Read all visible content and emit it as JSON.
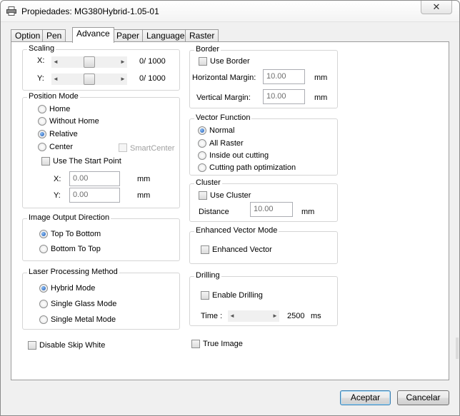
{
  "window": {
    "title": "Propiedades: MG380Hybrid-1.05-01",
    "close_glyph": "✕",
    "icon": "printer-icon"
  },
  "tabs": [
    {
      "label": "Option"
    },
    {
      "label": "Pen"
    },
    {
      "label": "Advance",
      "active": true
    },
    {
      "label": "Paper"
    },
    {
      "label": "Language"
    },
    {
      "label": "Raster"
    }
  ],
  "scaling": {
    "legend": "Scaling",
    "x_label": "X:",
    "x_value": "0/ 1000",
    "x_level": 0.5,
    "y_label": "Y:",
    "y_value": "0/ 1000",
    "y_level": 0.5
  },
  "position_mode": {
    "legend": "Position Mode",
    "options": [
      "Home",
      "Without Home",
      "Relative",
      "Center"
    ],
    "selected": "Relative",
    "smart_center": "SmartCenter",
    "use_start_point": "Use The Start Point",
    "x_label": "X:",
    "x_value": "0.00",
    "x_unit": "mm",
    "y_label": "Y:",
    "y_value": "0.00",
    "y_unit": "mm"
  },
  "image_output": {
    "legend": "Image Output Direction",
    "options": [
      "Top To Bottom",
      "Bottom To Top"
    ],
    "selected": "Top To Bottom"
  },
  "laser_processing": {
    "legend": "Laser Processing Method",
    "options": [
      "Hybrid Mode",
      "Single Glass Mode",
      "Single Metal Mode"
    ],
    "selected": "Hybrid Mode"
  },
  "disable_skip_white": "Disable Skip White",
  "border": {
    "legend": "Border",
    "use_border": "Use Border",
    "h_margin_label": "Horizontal Margin:",
    "h_margin_value": "10.00",
    "h_unit": "mm",
    "v_margin_label": "Vertical Margin:",
    "v_margin_value": "10.00",
    "v_unit": "mm"
  },
  "vector_function": {
    "legend": "Vector Function",
    "options": [
      "Normal",
      "All Raster",
      "Inside out cutting",
      "Cutting path optimization"
    ],
    "selected": "Normal"
  },
  "cluster": {
    "legend": "Cluster",
    "use_cluster": "Use Cluster",
    "distance_label": "Distance",
    "distance_value": "10.00",
    "unit": "mm"
  },
  "enhanced_vector": {
    "legend": "Enhanced Vector Mode",
    "checkbox": "Enhanced Vector"
  },
  "drilling": {
    "legend": "Drilling",
    "enable": "Enable Drilling",
    "time_label": "Time :",
    "time_value": "2500",
    "time_unit": "ms",
    "time_level": 0.0
  },
  "true_image": "True Image",
  "buttons": {
    "accept": "Aceptar",
    "cancel": "Cancelar"
  }
}
